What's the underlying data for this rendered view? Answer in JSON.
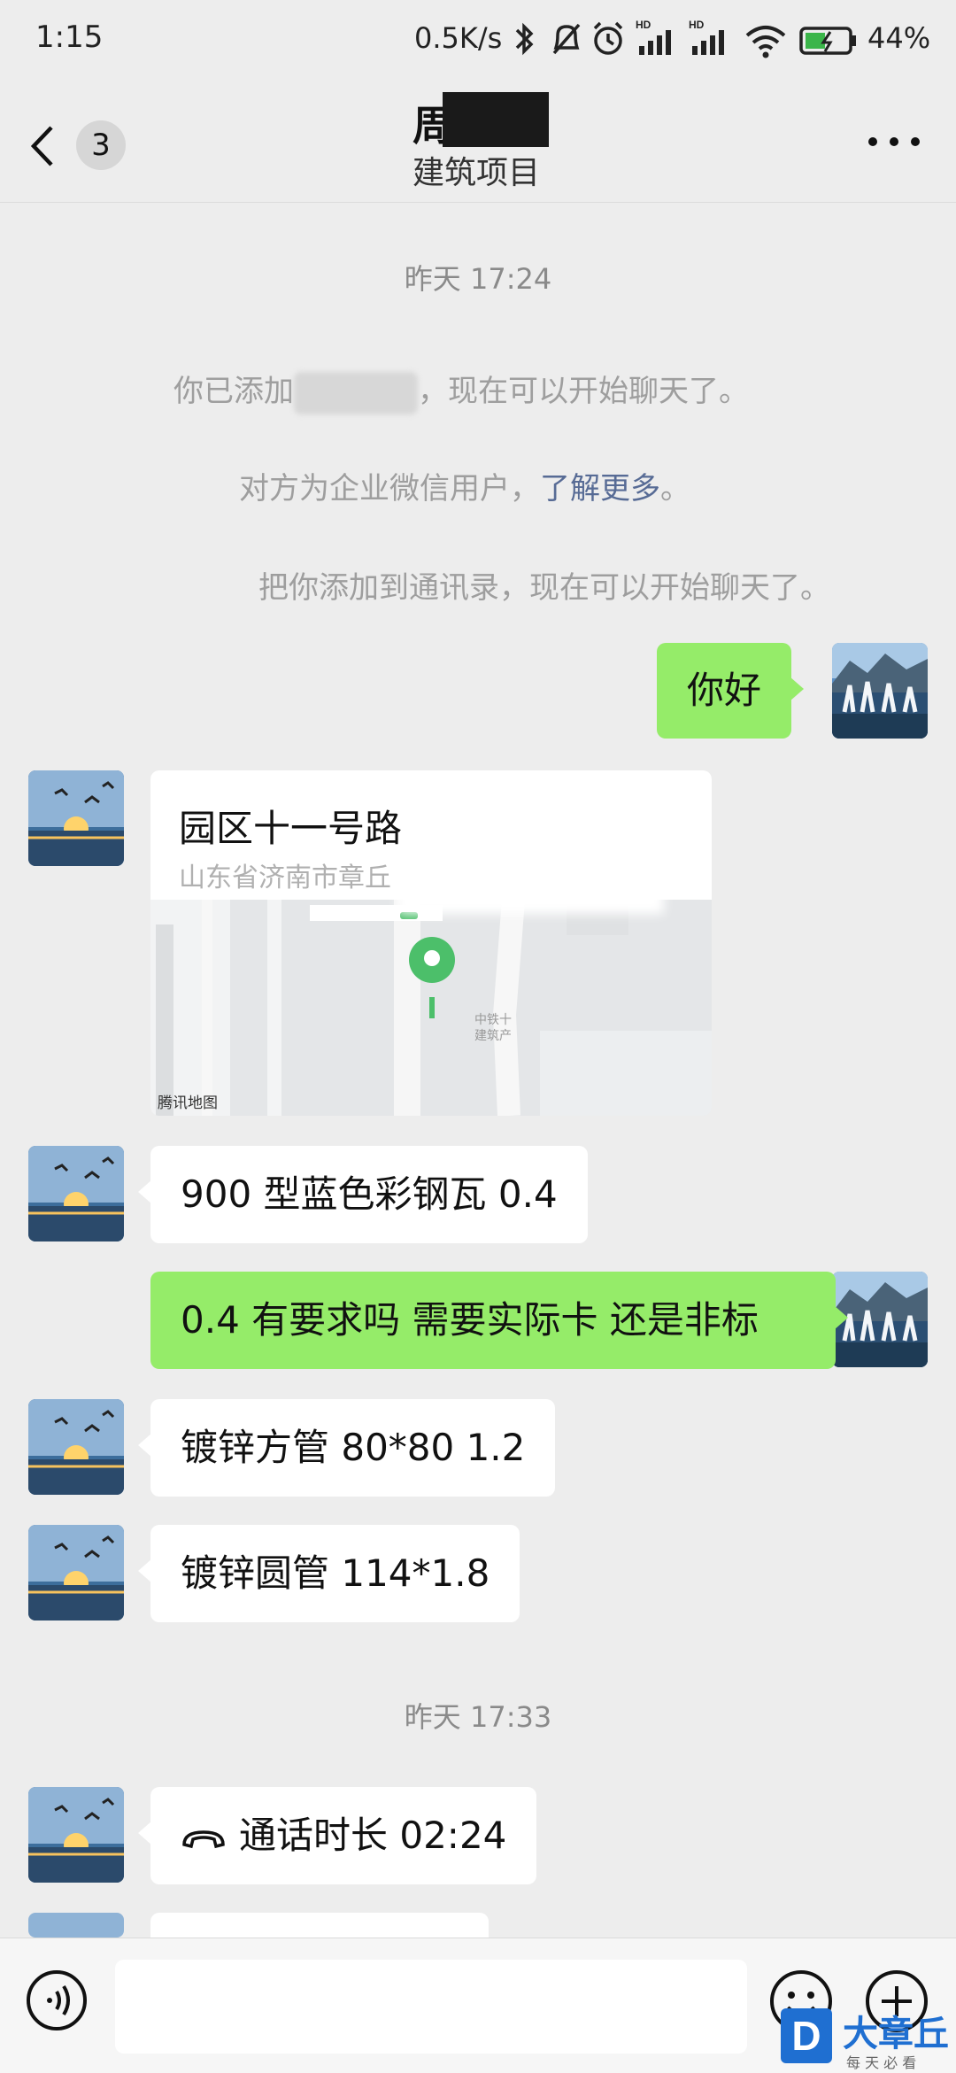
{
  "status_bar": {
    "time": "1:15",
    "net_speed": "0.5K/s",
    "battery_pct": "44%",
    "icons": [
      "bluetooth-icon",
      "mute-icon",
      "alarm-icon",
      "hd-signal-icon",
      "hd-signal-icon",
      "wifi-icon",
      "battery-icon"
    ]
  },
  "header": {
    "back_badge": "3",
    "name": "周",
    "subtitle": "建筑项目"
  },
  "messages": {
    "ts1": "昨天 17:24",
    "sys1_a": "你已添加",
    "sys1_b": "，现在可以开始聊天了。",
    "sys2_a": "对方为企业微信用户，",
    "sys2_link": "了解更多",
    "sys2_b": "。",
    "sys3": "把你添加到通讯录，现在可以开始聊天了。",
    "out1": "你好",
    "location": {
      "title": "园区十一号路",
      "address": "山东省济南市章丘",
      "map_label": "中铁十\n建筑产",
      "map_credit": "腾讯地图"
    },
    "in1": "900 型蓝色彩钢瓦 0.4",
    "out2": "0.4 有要求吗 需要实际卡 还是非标",
    "in2": "镀锌方管 80*80 1.2",
    "in3": "镀锌圆管 114*1.8",
    "ts2": "昨天 17:33",
    "call": "通话时长 02:24"
  },
  "input_bar": {
    "text_value": ""
  },
  "watermark": {
    "brand": "大章丘",
    "slogan": "每 天 必 看"
  },
  "colors": {
    "background": "#ededed",
    "bubble_out": "#95ec69",
    "bubble_in": "#ffffff",
    "link": "#576b95",
    "map_pin": "#4cbf6a"
  }
}
